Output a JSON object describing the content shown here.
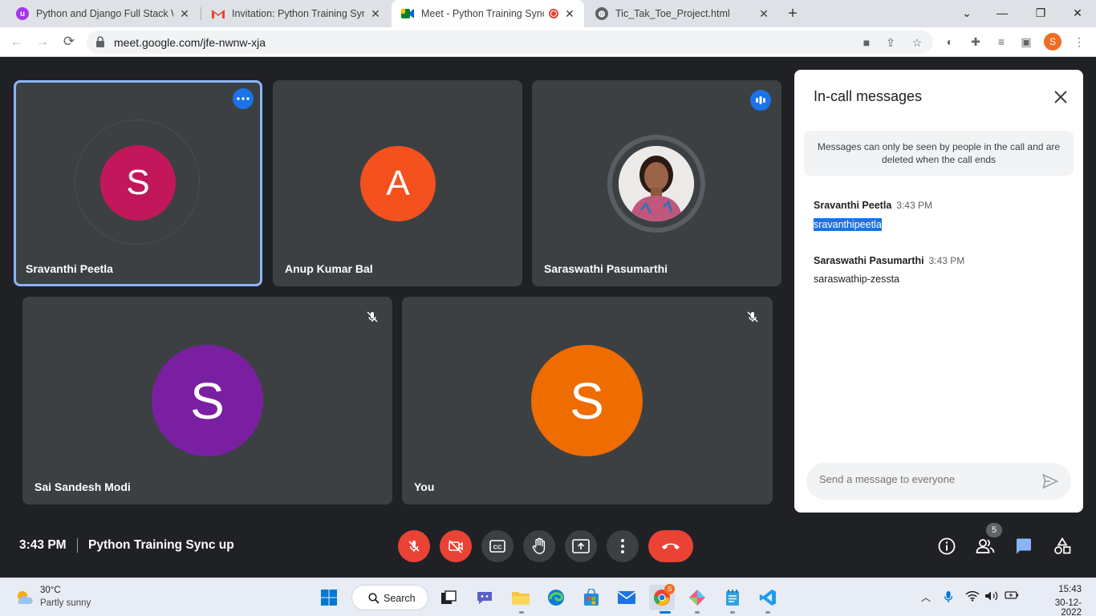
{
  "browser": {
    "tabs": [
      {
        "title": "Python and Django Full Stack We",
        "icon": "udemy-icon",
        "active": false
      },
      {
        "title": "Invitation: Python Training Sync u",
        "icon": "gmail-icon",
        "active": false
      },
      {
        "title": "Meet - Python Training Sync",
        "icon": "meet-icon",
        "active": true
      },
      {
        "title": "Tic_Tak_Toe_Project.html",
        "icon": "globe-icon",
        "active": false
      }
    ],
    "url": "meet.google.com/jfe-nwnw-xja",
    "profile_initial": "S"
  },
  "participants": [
    {
      "name": "Sravanthi Peetla",
      "initial": "S",
      "color": "#c2185b",
      "speaking": true
    },
    {
      "name": "Anup Kumar Bal",
      "initial": "A",
      "color": "#f4511e"
    },
    {
      "name": "Saraswathi Pasumarthi",
      "initial": "",
      "color": "#7a4b3a"
    },
    {
      "name": "Sai Sandesh Modi",
      "initial": "S",
      "color": "#7b1fa2",
      "muted": true
    },
    {
      "name": "You",
      "initial": "S",
      "color": "#ef6c00",
      "muted": true
    }
  ],
  "chat": {
    "title": "In-call messages",
    "notice": "Messages can only be seen by people in the call and are deleted when the call ends",
    "messages": [
      {
        "sender": "Sravanthi Peetla",
        "time": "3:43 PM",
        "text": "sravanthipeetla"
      },
      {
        "sender": "Saraswathi Pasumarthi",
        "time": "3:43 PM",
        "text": "saraswathip-zessta"
      }
    ],
    "input_placeholder": "Send a message to everyone"
  },
  "controls": {
    "time": "3:43 PM",
    "meeting_title": "Python Training Sync up",
    "people_count": "5"
  },
  "taskbar": {
    "temperature": "30°C",
    "weather": "Partly sunny",
    "search_label": "Search",
    "chrome_badge": "S",
    "clock_time": "15:43",
    "clock_date": "30-12-2022"
  },
  "colors": {
    "accent": "#1a73e8",
    "end_call": "#ea4335",
    "tile": "#3c4043",
    "stage": "#202124"
  }
}
